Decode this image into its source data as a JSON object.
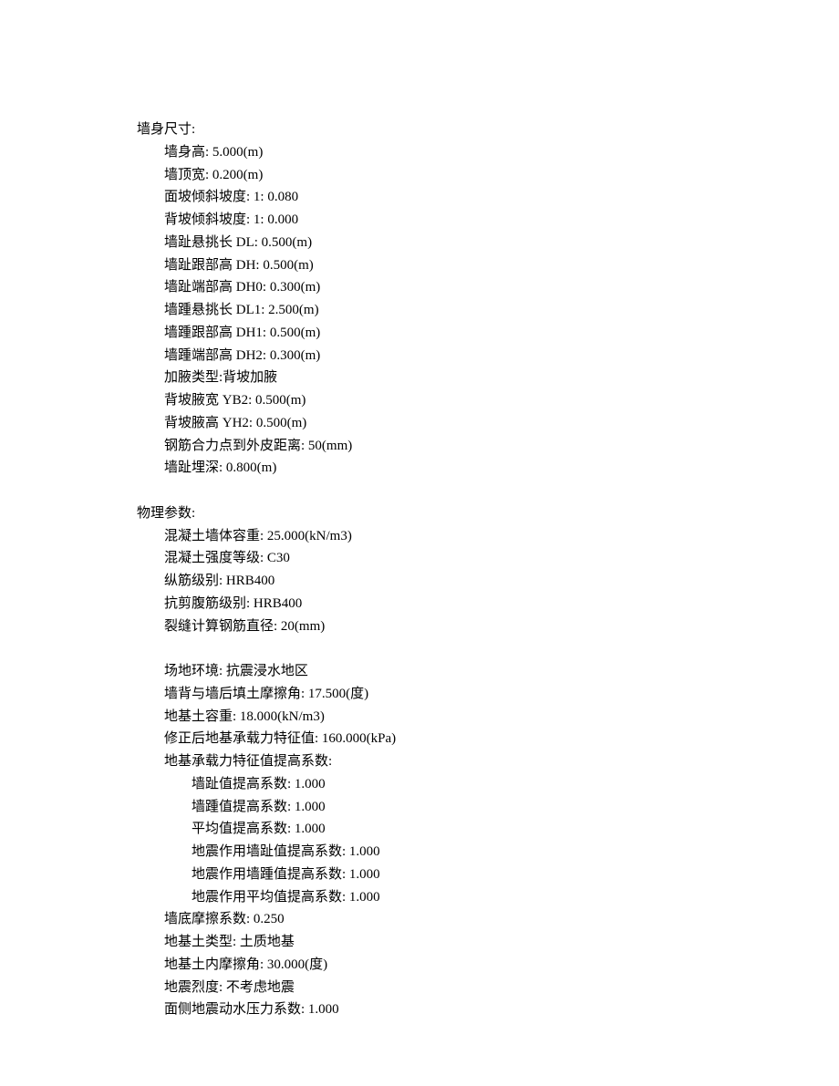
{
  "sections": {
    "wall_dimensions": {
      "title": "墙身尺寸:",
      "items": [
        "墙身高: 5.000(m)",
        "墙顶宽: 0.200(m)",
        "面坡倾斜坡度: 1: 0.080",
        "背坡倾斜坡度: 1: 0.000",
        "墙趾悬挑长 DL: 0.500(m)",
        "墙趾跟部高 DH: 0.500(m)",
        "墙趾端部高 DH0: 0.300(m)",
        "墙踵悬挑长 DL1: 2.500(m)",
        "墙踵跟部高 DH1: 0.500(m)",
        "墙踵端部高 DH2: 0.300(m)",
        "加腋类型:背坡加腋",
        "背坡腋宽 YB2: 0.500(m)",
        "背坡腋高 YH2: 0.500(m)",
        "钢筋合力点到外皮距离: 50(mm)",
        "墙趾埋深: 0.800(m)"
      ]
    },
    "physical_params": {
      "title": "物理参数:",
      "items_1": [
        "混凝土墙体容重: 25.000(kN/m3)",
        "混凝土强度等级: C30",
        "纵筋级别: HRB400",
        "抗剪腹筋级别: HRB400",
        "裂缝计算钢筋直径: 20(mm)"
      ],
      "items_2": [
        "场地环境: 抗震浸水地区",
        "墙背与墙后填土摩擦角: 17.500(度)",
        "地基土容重: 18.000(kN/m3)",
        "修正后地基承载力特征值: 160.000(kPa)",
        "地基承载力特征值提高系数:"
      ],
      "subitems": [
        "墙趾值提高系数: 1.000",
        "墙踵值提高系数: 1.000",
        "平均值提高系数: 1.000",
        "地震作用墙趾值提高系数: 1.000",
        "地震作用墙踵值提高系数: 1.000",
        "地震作用平均值提高系数: 1.000"
      ],
      "items_3": [
        "墙底摩擦系数: 0.250",
        "地基土类型: 土质地基",
        "地基土内摩擦角: 30.000(度)",
        "地震烈度: 不考虑地震",
        "面侧地震动水压力系数: 1.000"
      ]
    }
  }
}
